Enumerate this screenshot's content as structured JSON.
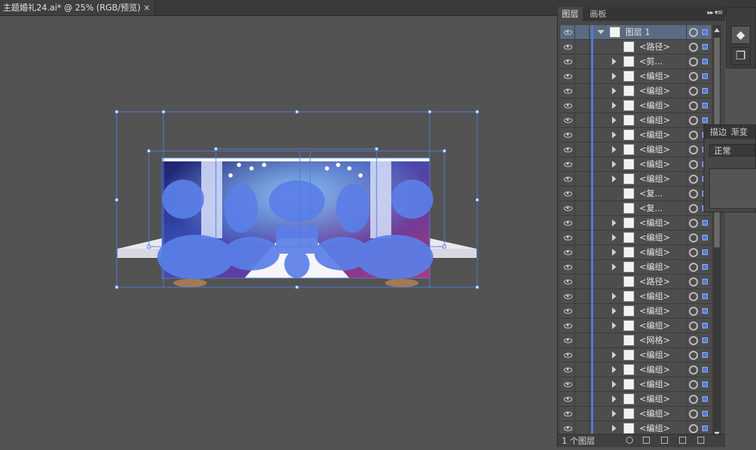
{
  "document_tab": {
    "title": "主题婚礼24.ai* @ 25% (RGB/预览)",
    "close": "×"
  },
  "layers_panel": {
    "tabs": [
      "图层",
      "画板"
    ],
    "menu_glyph": "▸▸ ▾≡",
    "top_layer": "图层 1",
    "rows": [
      {
        "name": "<路径>",
        "twirl": false
      },
      {
        "name": "<剪...",
        "twirl": true
      },
      {
        "name": "<编组>",
        "twirl": true
      },
      {
        "name": "<编组>",
        "twirl": true
      },
      {
        "name": "<编组>",
        "twirl": true
      },
      {
        "name": "<编组>",
        "twirl": true
      },
      {
        "name": "<编组>",
        "twirl": true
      },
      {
        "name": "<编组>",
        "twirl": true
      },
      {
        "name": "<编组>",
        "twirl": true
      },
      {
        "name": "<编组>",
        "twirl": true
      },
      {
        "name": "<复...",
        "twirl": false
      },
      {
        "name": "<复...",
        "twirl": false
      },
      {
        "name": "<编组>",
        "twirl": true
      },
      {
        "name": "<编组>",
        "twirl": true
      },
      {
        "name": "<编组>",
        "twirl": true
      },
      {
        "name": "<编组>",
        "twirl": true
      },
      {
        "name": "<路径>",
        "twirl": false
      },
      {
        "name": "<编组>",
        "twirl": true
      },
      {
        "name": "<编组>",
        "twirl": true
      },
      {
        "name": "<编组>",
        "twirl": true
      },
      {
        "name": "<网格>",
        "twirl": false
      },
      {
        "name": "<编组>",
        "twirl": true
      },
      {
        "name": "<编组>",
        "twirl": true
      },
      {
        "name": "<编组>",
        "twirl": true
      },
      {
        "name": "<编组>",
        "twirl": true
      },
      {
        "name": "<编组>",
        "twirl": true
      },
      {
        "name": "<编组>",
        "twirl": true
      }
    ],
    "footer_count": "1 个图层"
  },
  "float_panel": {
    "tabs": [
      "描边",
      "渐变"
    ],
    "blend_mode": "正常"
  },
  "colors": {
    "selection": "#4f7bd8",
    "canvas": "#535353",
    "panel": "#484848"
  }
}
